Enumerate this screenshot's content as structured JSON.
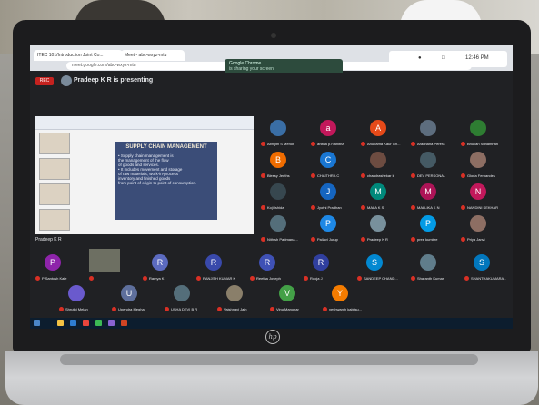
{
  "browser": {
    "tabs": [
      "ITEC 101/Introduction Joint Co...",
      "Meet - abc-wxyz-mtu"
    ],
    "url": "meet.google.com/abc-wxyz-mtu",
    "notification_title": "Google Chrome",
    "notification_body": "is sharing your screen."
  },
  "meet": {
    "rec_label": "REC",
    "presenting_text": "Pradeep K R is presenting",
    "time": "12:46 PM",
    "presenter_label": "Pradeep K R"
  },
  "slide": {
    "title": "SUPPLY CHAIN MANAGEMENT",
    "lines": [
      "• Supply chain management is",
      "  the management of the flow",
      "  of goods and services.",
      "• It includes movement and storage",
      "  of raw materials, work-in-process",
      "  inventory and finished goods",
      "  from point of origin to point of consumption."
    ]
  },
  "participants": [
    {
      "initial": "",
      "name": "Abhijith S Menon",
      "color": "#3a6ea5"
    },
    {
      "initial": "a",
      "name": "anitha p.h anitha",
      "color": "#c2185b"
    },
    {
      "initial": "A",
      "name": "Anupama Kaur Gh...",
      "color": "#e64a19"
    },
    {
      "initial": "",
      "name": "Aradhana Perera",
      "color": "#5d6d7e"
    },
    {
      "initial": "",
      "name": "Bhuvan Sunanthan",
      "color": "#2e7d32"
    },
    {
      "initial": "B",
      "name": "Blessy Jeeths",
      "color": "#ef6c00"
    },
    {
      "initial": "C",
      "name": "CHAITHRA C",
      "color": "#1976d2"
    },
    {
      "initial": "",
      "name": "chandrashekar k",
      "color": "#6d4c41"
    },
    {
      "initial": "",
      "name": "DEV PERSONAL",
      "color": "#455a64"
    },
    {
      "initial": "",
      "name": "Gloria Fernandes",
      "color": "#8d6e63"
    },
    {
      "initial": "",
      "name": "Koji Ishida",
      "color": "#37474f"
    },
    {
      "initial": "J",
      "name": "Jyothi Pradhan",
      "color": "#1565c0"
    },
    {
      "initial": "M",
      "name": "MALA K S",
      "color": "#00897b"
    },
    {
      "initial": "M",
      "name": "MALLIKA K N",
      "color": "#ad1457"
    },
    {
      "initial": "N",
      "name": "NANDINI SEKHAR",
      "color": "#c2185b"
    },
    {
      "initial": "",
      "name": "Nithish Padmana...",
      "color": "#546e7a"
    },
    {
      "initial": "P",
      "name": "Pallavi Jurup",
      "color": "#1e88e5"
    },
    {
      "initial": "",
      "name": "Pradeep K R",
      "color": "#78909c"
    },
    {
      "initial": "P",
      "name": "pree kumbre",
      "color": "#039be5"
    },
    {
      "initial": "",
      "name": "Priya Janvi",
      "color": "#8d6e63"
    },
    {
      "initial": "P",
      "name": "P Santosh Kale",
      "color": "#8e24aa"
    },
    {
      "initial": "",
      "name": "",
      "color": "#6d6f62"
    },
    {
      "initial": "R",
      "name": "Ramya K",
      "color": "#5c6bc0"
    },
    {
      "initial": "R",
      "name": "RANJITH KUMAR K",
      "color": "#3949ab"
    },
    {
      "initial": "R",
      "name": "Reetha Joseph",
      "color": "#3f51b5"
    },
    {
      "initial": "R",
      "name": "Rooja J",
      "color": "#303f9f"
    },
    {
      "initial": "S",
      "name": "SANDEEP CHAND...",
      "color": "#0288d1"
    },
    {
      "initial": "",
      "name": "Sharanth Kumar",
      "color": "#607d8b"
    },
    {
      "initial": "S",
      "name": "SHANTHAKUMARA...",
      "color": "#0277bd"
    },
    {
      "initial": "",
      "name": "Shruthi Melan",
      "color": "#6a5acd"
    },
    {
      "initial": "U",
      "name": "Upendra Megha",
      "color": "#5e6f9c"
    },
    {
      "initial": "",
      "name": "USHA DEVI B R",
      "color": "#546e7a"
    },
    {
      "initial": "",
      "name": "Vaishnavi Jain",
      "color": "#8a7f6a"
    },
    {
      "initial": "V",
      "name": "Vinu Manohar",
      "color": "#43a047"
    },
    {
      "initial": "Y",
      "name": "yeshwanth kabilsu...",
      "color": "#f57c00"
    }
  ],
  "device": {
    "brand": "hp"
  }
}
